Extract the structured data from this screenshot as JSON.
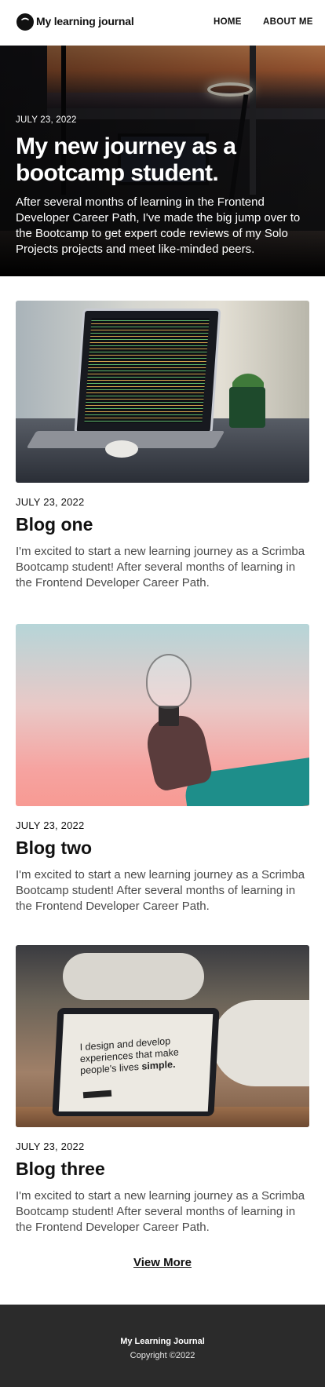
{
  "header": {
    "brand": "My learning journal",
    "nav": [
      {
        "label": "HOME"
      },
      {
        "label": "ABOUT ME"
      }
    ]
  },
  "hero": {
    "date": "JULY 23, 2022",
    "title": "My new journey as a bootcamp student.",
    "text": "After several months of learning in the Frontend Developer Career Path, I've made the big jump over to the Bootcamp to get expert code reviews of my Solo Projects projects and meet like-minded peers."
  },
  "posts": [
    {
      "date": "JULY 23, 2022",
      "title": "Blog one",
      "text": "I'm excited to start a new learning journey as a Scrimba Bootcamp student! After several months of learning in the Frontend Developer Career Path."
    },
    {
      "date": "JULY 23, 2022",
      "title": "Blog two",
      "text": "I'm excited to start a new learning journey as a Scrimba Bootcamp student! After several months of learning in the Frontend Developer Career Path."
    },
    {
      "date": "JULY 23, 2022",
      "title": "Blog three",
      "text": "I'm excited to start a new learning journey as a Scrimba Bootcamp student! After several months of learning in the Frontend Developer Career Path.",
      "image_text_line1": "I design and develop",
      "image_text_line2": "experiences that make",
      "image_text_line3": "people's lives",
      "image_text_bold": "simple."
    }
  ],
  "view_more": "View More",
  "footer": {
    "brand": "My Learning Journal",
    "copyright": "Copyright ©2022"
  },
  "icons": {
    "logo": "chat-bubble-icon"
  },
  "colors": {
    "footer_bg": "#2b2b2b",
    "text": "#111111",
    "muted_text": "#4a4a4a"
  }
}
